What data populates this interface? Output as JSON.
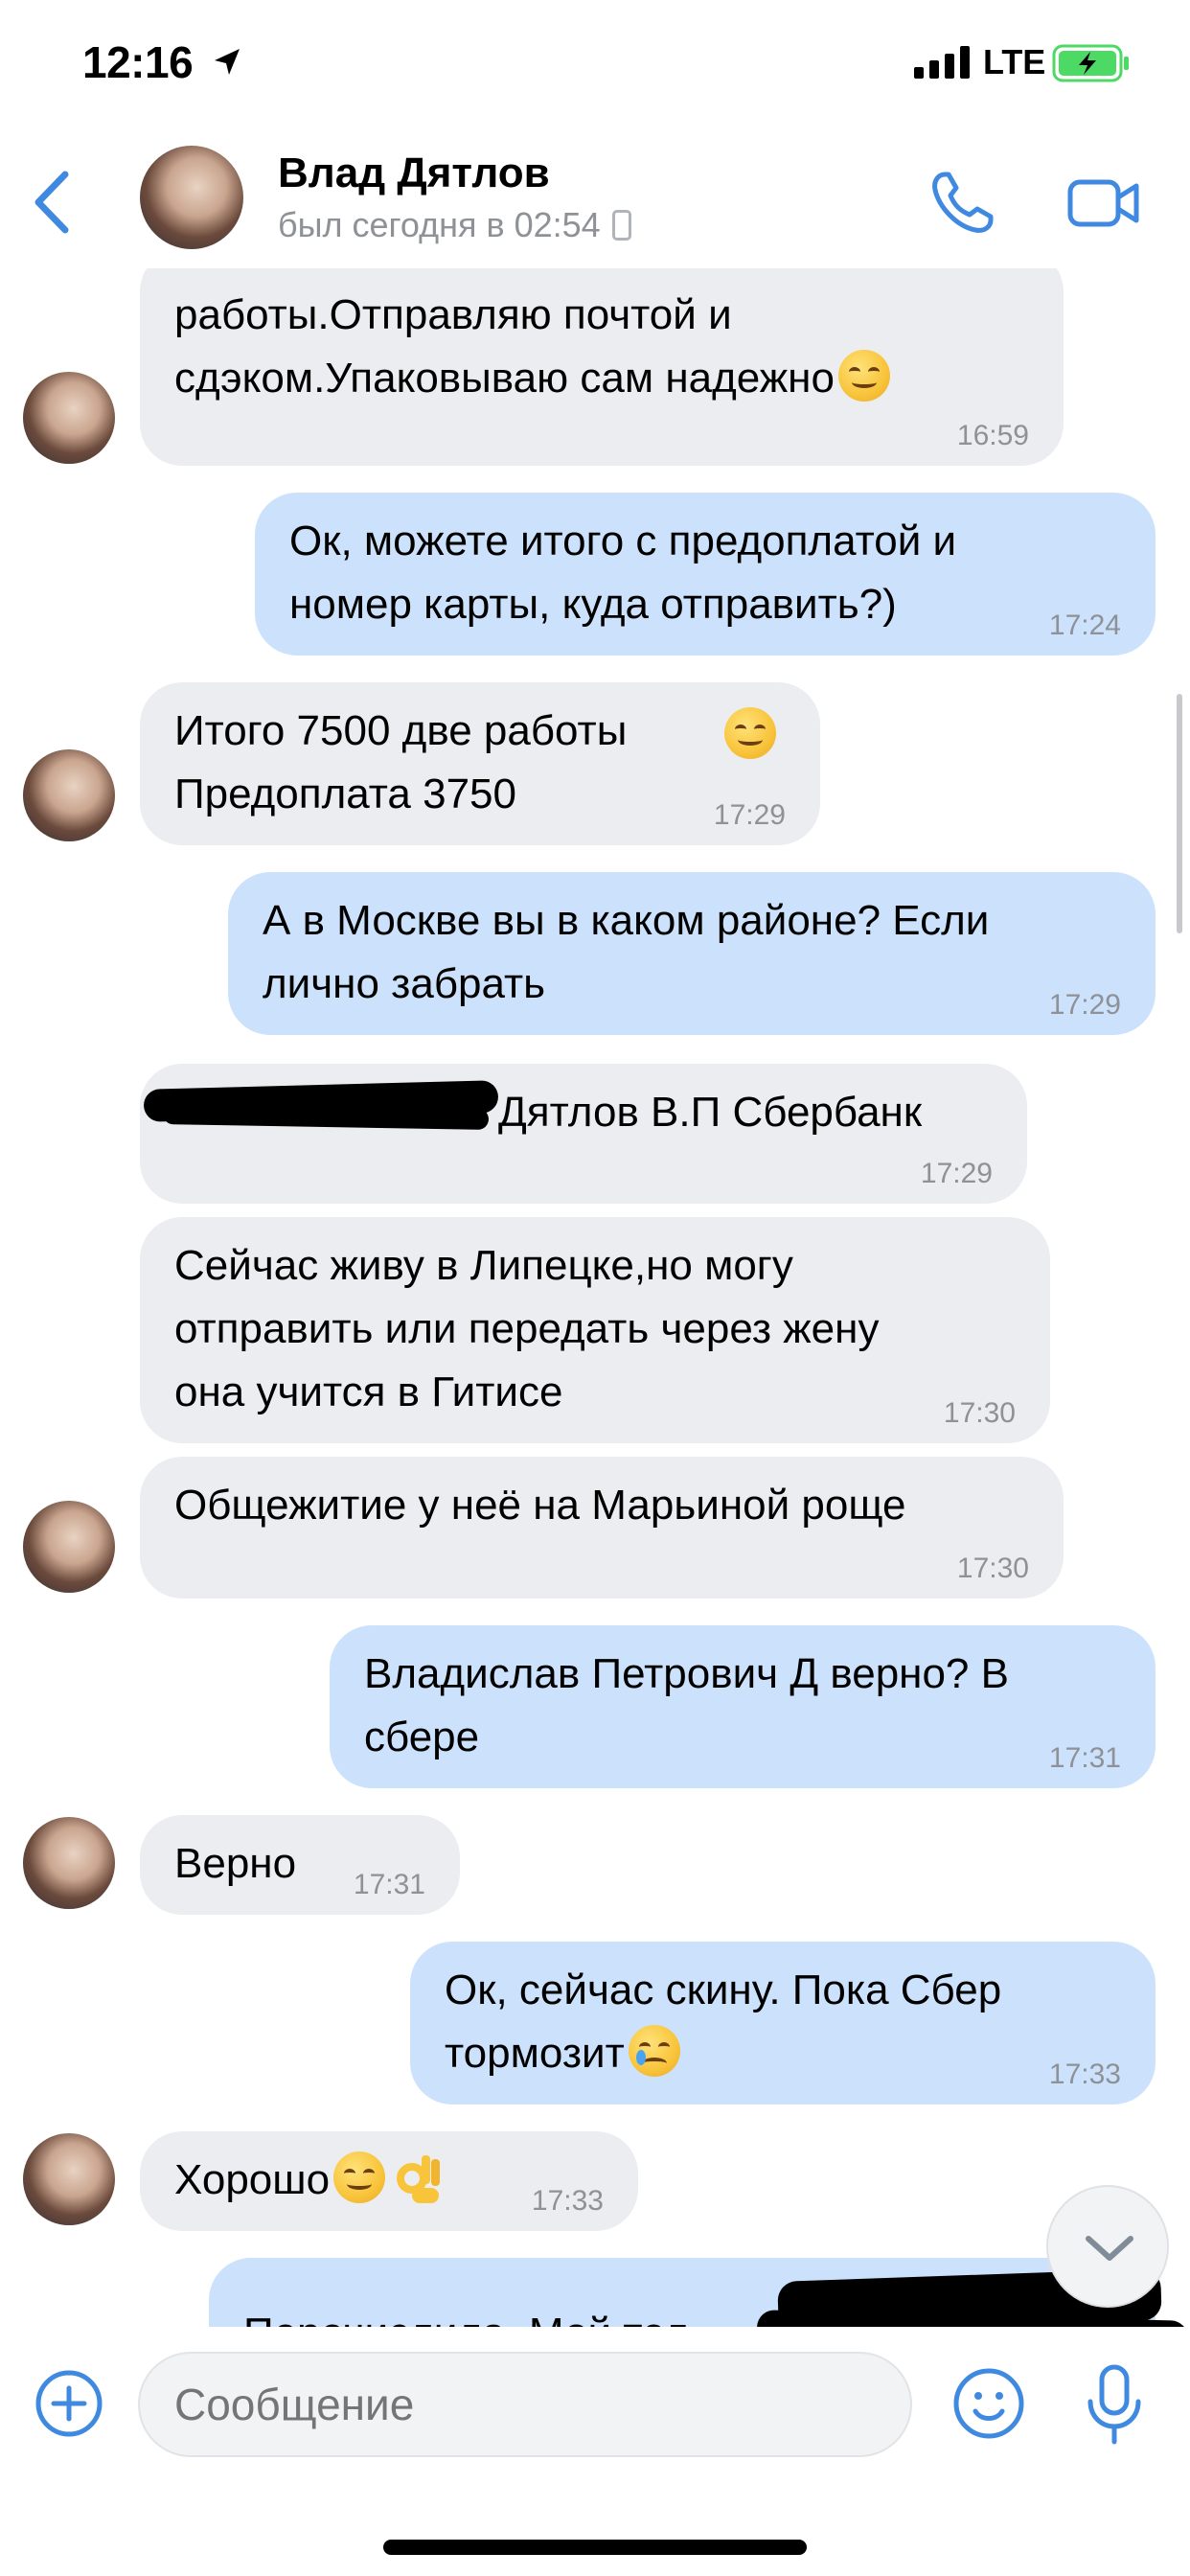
{
  "status_bar": {
    "time": "12:16",
    "network": "LTE"
  },
  "header": {
    "name": "Влад Дятлов",
    "status": "был сегодня в 02:54"
  },
  "messages": [
    {
      "dir": "in",
      "text": "работы.Отправляю почтой и\nсдэком.Упаковываю сам надежно",
      "time": "16:59"
    },
    {
      "dir": "out",
      "text": "Ок, можете итого с предоплатой и\nномер карты, куда отправить?)",
      "time": "17:24"
    },
    {
      "dir": "in",
      "text": "Итого 7500 две работы\nПредоплата 3750",
      "time": "17:29"
    },
    {
      "dir": "out",
      "text": "А в Москве вы в каком районе? Если\nлично забрать",
      "time": "17:29"
    },
    {
      "dir": "in",
      "text": "Дятлов В.П Сбербанк",
      "time": "17:29"
    },
    {
      "dir": "in",
      "text": "Сейчас живу в Липецке,но могу\nотправить или передать через жену\nона учится в Гитисе",
      "time": "17:30"
    },
    {
      "dir": "in",
      "text": "Общежитие у неё на Марьиной роще",
      "time": "17:30"
    },
    {
      "dir": "out",
      "text": "Владислав Петрович Д верно? В\nсбере",
      "time": "17:31"
    },
    {
      "dir": "in",
      "text": "Верно",
      "time": "17:31"
    },
    {
      "dir": "out",
      "text": "Ок, сейчас скину. Пока Сбер\nтормозит",
      "time": "17:33"
    },
    {
      "dir": "in",
      "text": "Хорошо",
      "time": "17:33"
    },
    {
      "dir": "out",
      "text": "Перечислила. Мой тел",
      "time": ""
    }
  ],
  "composer": {
    "placeholder": "Сообщение"
  },
  "colors": {
    "accent": "#3f8ae0",
    "incoming": "#ebedf0",
    "outgoing": "#cce2fc"
  }
}
